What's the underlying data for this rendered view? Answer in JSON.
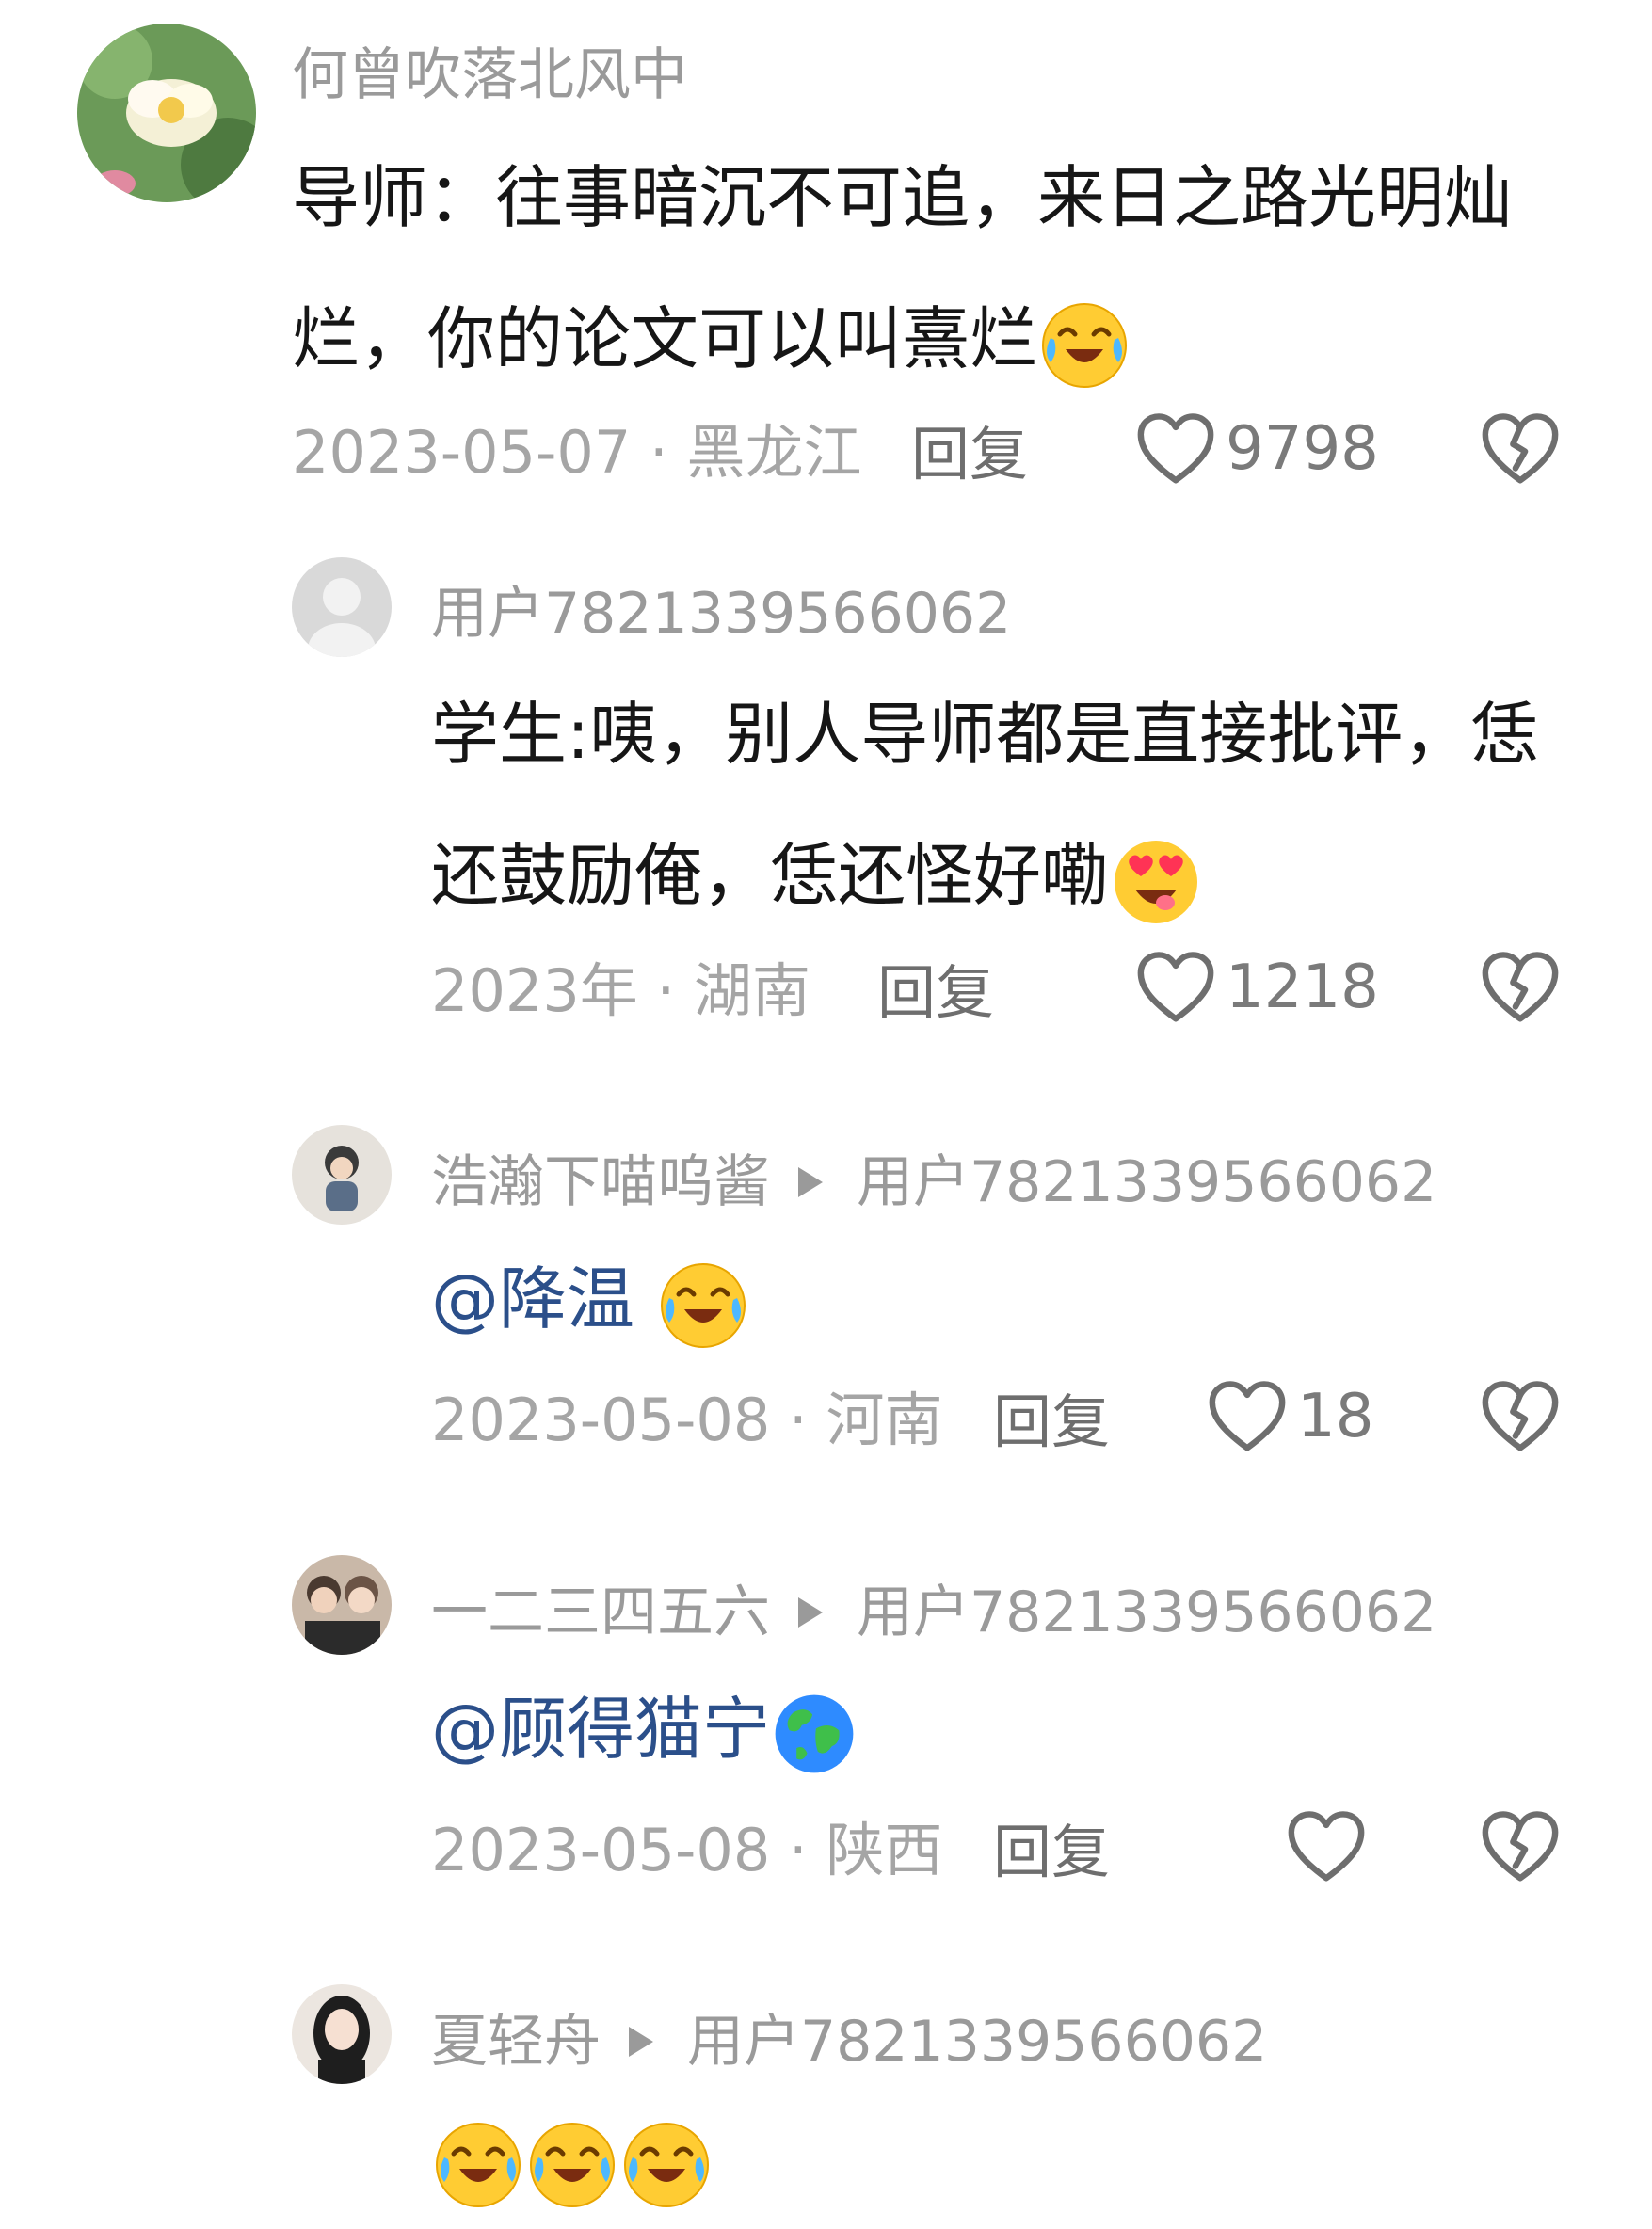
{
  "comments": [
    {
      "username": "何曾吹落北风中",
      "text_line1": "导师：往事暗沉不可追，来日之路光明灿",
      "text_line2": "烂，你的论文可以叫熹烂",
      "emoji": "crying-laughing-emoji",
      "date": "2023-05-07",
      "location": "黑龙江",
      "reply_label": "回复",
      "likes": "9798"
    },
    {
      "username": "用户7821339566062",
      "text_line1": "学生:咦，别人导师都是直接批评，恁",
      "text_line2": "还鼓励俺，恁还怪好嘞",
      "emoji": "heart-eyes-emoji",
      "date": "2023年",
      "location": "湖南",
      "reply_label": "回复",
      "likes": "1218"
    },
    {
      "username": "浩瀚下喵呜酱",
      "reply_to": "用户7821339566062",
      "mention": "@降温",
      "emoji": "crying-laughing-emoji",
      "date": "2023-05-08",
      "location": "河南",
      "reply_label": "回复",
      "likes": "18"
    },
    {
      "username": "一二三四五六",
      "reply_to": "用户7821339566062",
      "mention": "@顾得猫宁",
      "emoji": "globe-emoji",
      "date": "2023-05-08",
      "location": "陕西",
      "reply_label": "回复",
      "likes": ""
    },
    {
      "username": "夏轻舟",
      "reply_to": "用户7821339566062",
      "emoji": "crying-laughing-emoji"
    }
  ],
  "meta_separator": " · ",
  "colors": {
    "username": "#9a9a9a",
    "meta": "#a5a5a5",
    "mention": "#2b4f8a",
    "text": "#161616"
  }
}
